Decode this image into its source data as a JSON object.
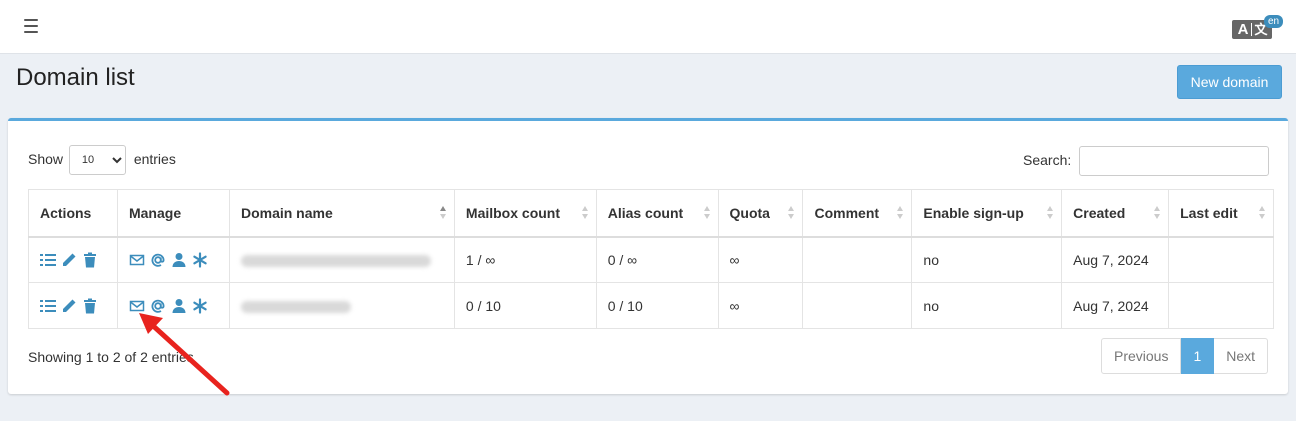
{
  "header": {
    "menu_icon": "hamburger-icon",
    "lang_icon": "translate-icon",
    "lang_code": "en",
    "lang_glyph_a": "A",
    "lang_glyph_b": "文"
  },
  "page": {
    "title": "Domain list",
    "new_button": "New domain"
  },
  "controls": {
    "show_label": "Show",
    "entries_label": "entries",
    "page_size": "10",
    "search_label": "Search:",
    "search_value": ""
  },
  "table": {
    "columns": [
      "Actions",
      "Manage",
      "Domain name",
      "Mailbox count",
      "Alias count",
      "Quota",
      "Comment",
      "Enable sign-up",
      "Created",
      "Last edit"
    ],
    "rows": [
      {
        "domain": "",
        "mailbox_count": "1 / ∞",
        "alias_count": "0 / ∞",
        "quota": "∞",
        "comment": "",
        "signup": "no",
        "created": "Aug 7, 2024",
        "last_edit": ""
      },
      {
        "domain": "",
        "mailbox_count": "0 / 10",
        "alias_count": "0 / 10",
        "quota": "∞",
        "comment": "",
        "signup": "no",
        "created": "Aug 7, 2024",
        "last_edit": ""
      }
    ],
    "action_icons": [
      "list-icon",
      "pencil-icon",
      "trash-icon"
    ],
    "manage_icons": [
      "envelope-icon",
      "at-icon",
      "user-icon",
      "asterisk-icon"
    ]
  },
  "footer": {
    "info": "Showing 1 to 2 of 2 entries",
    "prev": "Previous",
    "current_page": "1",
    "next": "Next"
  },
  "colors": {
    "accent": "#5aa9dd",
    "annotation": "#e8231e"
  }
}
